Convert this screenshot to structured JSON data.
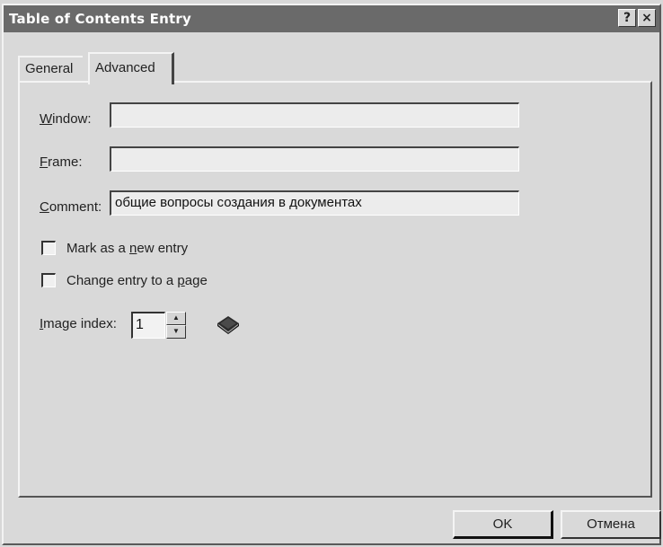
{
  "window": {
    "title": "Table of Contents Entry",
    "help_label": "?",
    "close_label": "×"
  },
  "tabs": [
    {
      "label": "General",
      "active": false
    },
    {
      "label": "Advanced",
      "active": true
    }
  ],
  "form": {
    "window_label_key": "W",
    "window_label_rest": "indow:",
    "window_value": "",
    "frame_label_key": "F",
    "frame_label_rest": "rame:",
    "frame_value": "",
    "comment_label_key": "C",
    "comment_label_rest": "omment:",
    "comment_value": "общие вопросы создания в документах",
    "mark_new_prefix": "Mark as a ",
    "mark_new_key": "n",
    "mark_new_suffix": "ew entry",
    "mark_new_checked": false,
    "change_page_prefix": "Change entry to a ",
    "change_page_key": "p",
    "change_page_suffix": "age",
    "change_page_checked": false,
    "image_index_key": "I",
    "image_index_rest": "mage index:",
    "image_index_value": "1",
    "image_icon": "book-icon"
  },
  "buttons": {
    "ok": "OK",
    "cancel": "Отмена"
  }
}
